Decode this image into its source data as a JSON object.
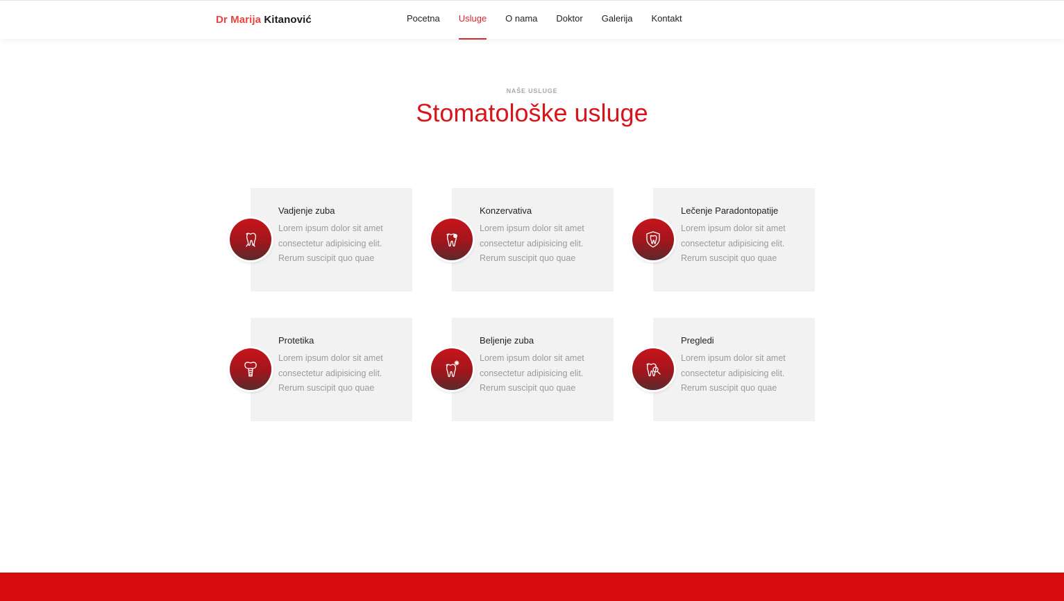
{
  "brand": {
    "first": "Dr Marija",
    "last": "Kitanović"
  },
  "nav": [
    {
      "label": "Pocetna",
      "active": false
    },
    {
      "label": "Usluge",
      "active": true
    },
    {
      "label": "O nama",
      "active": false
    },
    {
      "label": "Doktor",
      "active": false
    },
    {
      "label": "Galerija",
      "active": false
    },
    {
      "label": "Kontakt",
      "active": false
    }
  ],
  "section": {
    "subtitle": "NAŠE USLUGE",
    "title": "Stomatološke usluge"
  },
  "services": [
    {
      "title": "Vadjenje zuba",
      "icon": "tooth-extraction-icon",
      "lines": [
        "Lorem ipsum dolor sit amet",
        "consectetur adipisicing elit.",
        "Rerum suscipit quo quae"
      ]
    },
    {
      "title": "Konzervativa",
      "icon": "tooth-filling-icon",
      "lines": [
        "Lorem ipsum dolor sit amet",
        "consectetur adipisicing elit.",
        "Rerum suscipit quo quae"
      ]
    },
    {
      "title": "Lečenje Paradontopatije",
      "icon": "tooth-shield-icon",
      "lines": [
        "Lorem ipsum dolor sit amet",
        "consectetur adipisicing elit.",
        "Rerum suscipit quo quae"
      ]
    },
    {
      "title": "Protetika",
      "icon": "dental-implant-icon",
      "lines": [
        "Lorem ipsum dolor sit amet",
        "consectetur adipisicing elit.",
        "Rerum suscipit quo quae"
      ]
    },
    {
      "title": "Beljenje zuba",
      "icon": "tooth-whitening-icon",
      "lines": [
        "Lorem ipsum dolor sit amet",
        "consectetur adipisicing elit.",
        "Rerum suscipit quo quae"
      ]
    },
    {
      "title": "Pregledi",
      "icon": "tooth-checkup-icon",
      "lines": [
        "Lorem ipsum dolor sit amet",
        "consectetur adipisicing elit.",
        "Rerum suscipit quo quae"
      ]
    }
  ],
  "colors": {
    "accent": "#d9141b",
    "brand_first": "#e8453c",
    "footer": "#d60c0c",
    "card_bg": "#f2f2f2"
  }
}
